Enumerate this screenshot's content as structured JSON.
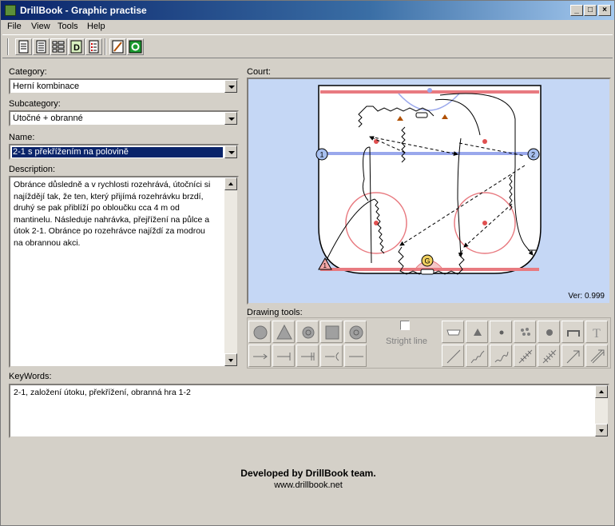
{
  "window": {
    "title": "DrillBook - Graphic practise"
  },
  "menu": [
    "File",
    "View",
    "Tools",
    "Help"
  ],
  "toolbar": {
    "icons": [
      "list-detail-icon",
      "list-icon",
      "list-small-icon",
      "drill-d-icon",
      "notes-list-icon",
      "pencil-icon",
      "ok-green-icon"
    ]
  },
  "form": {
    "category_label": "Category:",
    "category_value": "Herní kombinace",
    "subcategory_label": "Subcategory:",
    "subcategory_value": "Útočné + obranné",
    "name_label": "Name:",
    "name_value": "2-1 s překřížením na polovině",
    "description_label": "Description:",
    "description_text": "Obránce důsledně a v rychlosti rozehrává, útočníci si\nnajíždějí tak, že ten, který přijímá rozehrávku brzdí,\ndruhý se pak přiblíží po obloučku cca 4 m od\nmantinelu. Následuje nahrávka, přejřížení na půlce a\nútok 2-1. Obránce po rozehrávce najíždí za modrou\nna obrannou akci.",
    "keywords_label": "KeyWords:",
    "keywords_text": "2-1, založení útoku, překřížení, obranná hra 1-2"
  },
  "court": {
    "label": "Court:",
    "version": "Ver: 0.999",
    "markers": {
      "player1": "1",
      "player2": "2",
      "goalie": "G",
      "triangle": "1"
    }
  },
  "drawing_tools": {
    "label": "Drawing tools:",
    "straight_line_label": "Stright line",
    "straight_line_checked": false,
    "text_tool_glyph": "T"
  },
  "footer": {
    "developed_by": "Developed by DrillBook team.",
    "website": "www.drillbook.net"
  },
  "colors": {
    "title_start": "#0a246a",
    "title_end": "#a6caf0",
    "court_bg": "#c5d7f5",
    "rink_red": "#e87a80",
    "rink_blue": "#9aa8ec"
  }
}
